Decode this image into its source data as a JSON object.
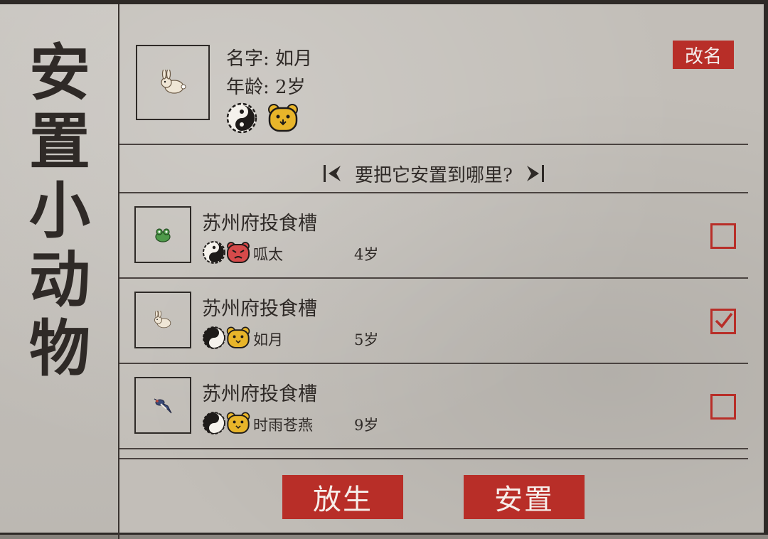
{
  "sidebar": {
    "title": "安置小动物"
  },
  "current_pet": {
    "avatar_icon": "rabbit-icon",
    "name_label": "名字: 如月",
    "age_label": "年龄:  2岁",
    "badges": [
      "yin-yang-icon",
      "bear-face-icon"
    ],
    "rename_label": "改名"
  },
  "prompt": {
    "text": "要把它安置到哪里?"
  },
  "slots": [
    {
      "location": "苏州府投食槽",
      "animal_icon": "frog-icon",
      "badges": [
        "yin-yang-light-icon",
        "angry-face-icon"
      ],
      "name": "呱太",
      "age": "4岁",
      "checked": false
    },
    {
      "location": "苏州府投食槽",
      "animal_icon": "rabbit-icon",
      "badges": [
        "yin-yang-dark-icon",
        "bear-face-icon"
      ],
      "name": "如月",
      "age": "5岁",
      "checked": true
    },
    {
      "location": "苏州府投食槽",
      "animal_icon": "swallow-icon",
      "badges": [
        "yin-yang-dark-icon",
        "bear-face-icon"
      ],
      "name": "时雨苍燕",
      "age": "9岁",
      "checked": false
    }
  ],
  "actions": {
    "release_label": "放生",
    "place_label": "安置"
  },
  "colors": {
    "accent_red": "#b82e28",
    "ink": "#2e2a27",
    "paper": "#c2beb8",
    "badge_yellow": "#e8b52a"
  }
}
